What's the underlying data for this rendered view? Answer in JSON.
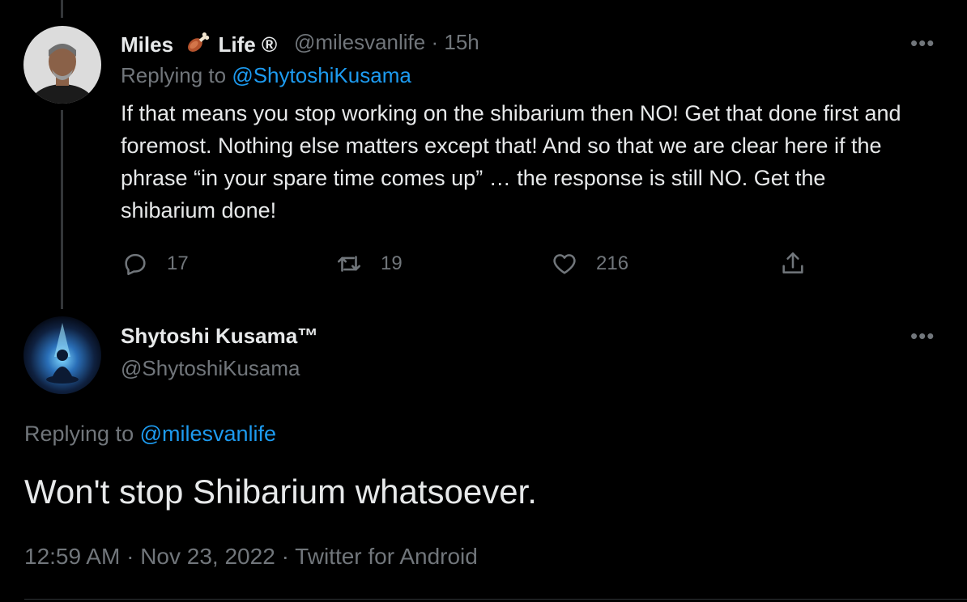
{
  "reply_tweet": {
    "display_name": "Miles",
    "emoji_badge": "meat-on-bone-icon",
    "display_name_suffix": "Life ®",
    "handle": "@milesvanlife",
    "separator": "·",
    "time": "15h",
    "replying_prefix": "Replying to",
    "replying_to": "@ShytoshiKusama",
    "text": "If that means you stop working on the shibarium then NO! Get that done first and foremost. Nothing else matters except that! And so that we are clear here if the phrase “in your spare time comes up” … the response is still NO. Get the shibarium done!",
    "more_label": "•••",
    "actions": {
      "replies": "17",
      "retweets": "19",
      "likes": "216"
    }
  },
  "main_tweet": {
    "display_name": "Shytoshi Kusama™",
    "handle": "@ShytoshiKusama",
    "more_label": "•••",
    "replying_prefix": "Replying to",
    "replying_to": "@milesvanlife",
    "text": "Won't stop Shibarium whatsoever.",
    "time": "12:59 AM",
    "separator": "·",
    "date": "Nov 23, 2022",
    "source": "Twitter for Android"
  },
  "colors": {
    "background": "#000000",
    "text": "#e7e9ea",
    "muted": "#71767b",
    "accent": "#1d9bf0",
    "thread_line": "#333639"
  }
}
